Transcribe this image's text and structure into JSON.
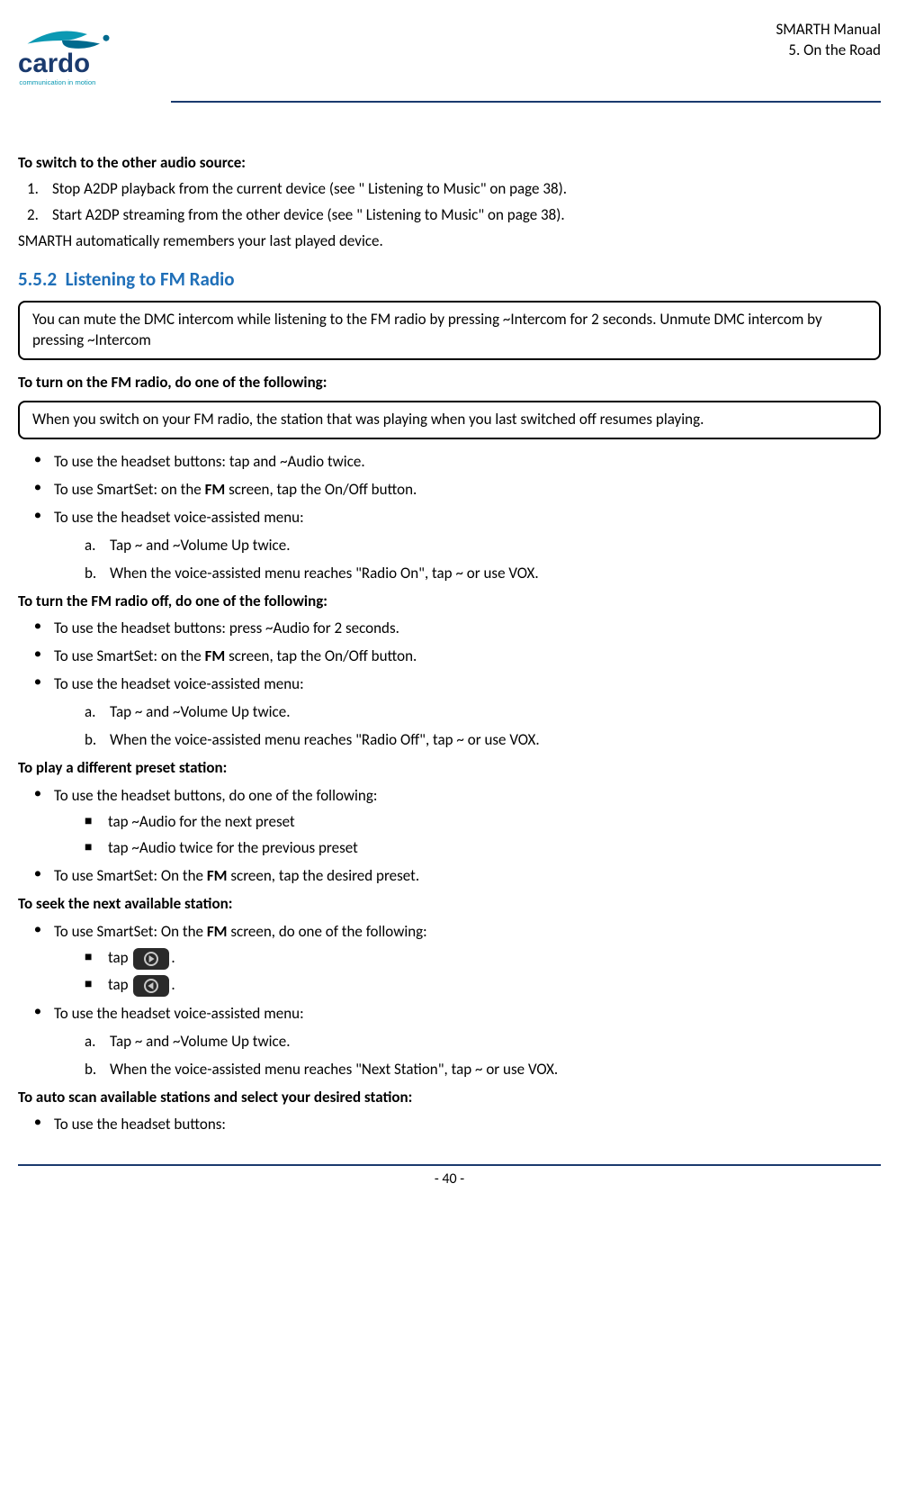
{
  "header": {
    "manual_title": "SMARTH  Manual",
    "section_title": "5.  On the Road",
    "logo_tagline": "communication in motion"
  },
  "content": {
    "switch_heading": "To switch to the other audio source:",
    "switch_steps": [
      "Stop A2DP playback from the current device (see \" Listening to Music\" on page 38).",
      "Start A2DP streaming from the other device (see \" Listening to Music\" on page 38)."
    ],
    "switch_note": "SMARTH automatically remembers your last played device.",
    "section_number": "5.5.2",
    "section_title": "Listening to FM  Radio",
    "note1": "You can mute the DMC intercom while listening to the FM radio by pressing ~Intercom for 2 seconds. Unmute DMC intercom by pressing ~Intercom",
    "turn_on_heading": "To turn on the FM radio, do one of the following:",
    "note2": "When you switch on your FM radio, the station that was playing when you last switched off resumes playing.",
    "turn_on_bullets": {
      "b1": "To use the headset buttons: tap and ~Audio  twice.",
      "b2_prefix": "To use SmartSet: on the ",
      "b2_bold": "FM",
      "b2_suffix": " screen, tap the On/Off  button.",
      "b3": "To use the headset voice-assisted menu:",
      "b3a": "Tap ~ and ~Volume Up  twice.",
      "b3b": "When the voice-assisted menu reaches \"Radio On\", tap ~ or use VOX."
    },
    "turn_off_heading": "To turn the FM radio off, do one of the following:",
    "turn_off_bullets": {
      "b1": "To use the headset buttons: press ~Audio for 2  seconds.",
      "b2_prefix": "To use SmartSet: on the ",
      "b2_bold": "FM",
      "b2_suffix": " screen, tap the On/Off  button.",
      "b3": "To use the headset voice-assisted menu:",
      "b3a": "Tap ~ and ~Volume Up  twice.",
      "b3b": "When the voice-assisted menu reaches \"Radio Off\", tap ~ or use VOX."
    },
    "preset_heading": "To play a different preset station:",
    "preset_bullets": {
      "b1": "To use the headset buttons, do one of the following:",
      "b1s1": "tap ~Audio for the next  preset",
      "b1s2": "tap ~Audio twice for the previous  preset",
      "b2_prefix": "To use SmartSet: On the ",
      "b2_bold": "FM",
      "b2_suffix": " screen, tap the desired  preset."
    },
    "seek_heading": "To seek the next available station:",
    "seek_bullets": {
      "b1_prefix": "To use SmartSet: On the ",
      "b1_bold": "FM",
      "b1_suffix": " screen, do one of the following:",
      "tap_label": "tap",
      "b2": "To use the headset voice-assisted menu:",
      "b2a": "Tap ~ and ~Volume Up  twice.",
      "b2b": "When the voice-assisted menu reaches \"Next Station\", tap ~ or use  VOX."
    },
    "auto_scan_heading": "To auto scan available stations and select your desired station:",
    "auto_scan_bullets": {
      "b1": "To use the headset  buttons:"
    }
  },
  "footer": {
    "page": "- 40 -"
  }
}
